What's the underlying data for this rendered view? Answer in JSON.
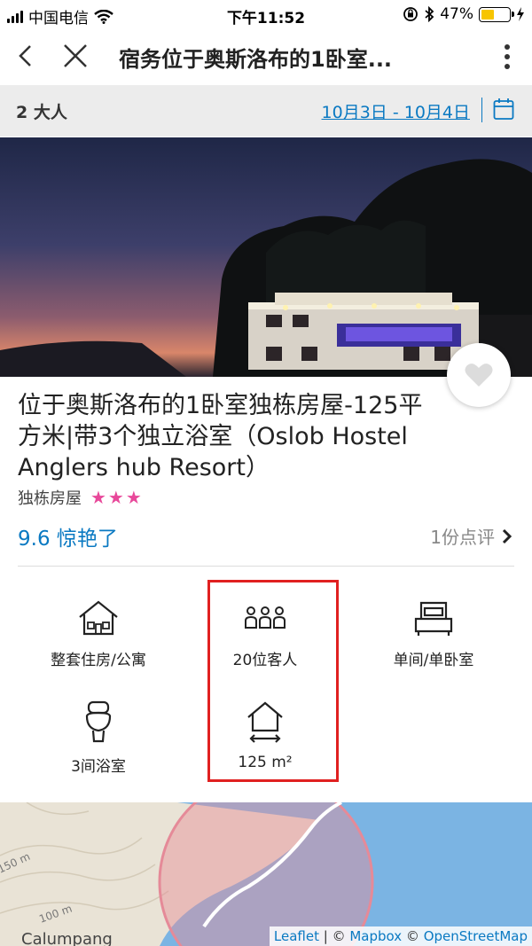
{
  "status_bar": {
    "carrier": "中国电信",
    "time": "下午11:52",
    "battery": "47%",
    "battery_level": 0.47
  },
  "nav": {
    "title": "宿务位于奥斯洛布的1卧室..."
  },
  "search": {
    "guests": "2 大人",
    "dates": "10月3日 - 10月4日"
  },
  "property": {
    "name": "位于奥斯洛布的1卧室独栋房屋-125平方米|带3个独立浴室（Oslob Hostel Anglers hub Resort）",
    "type": "独栋房屋",
    "stars": "★★★",
    "star_count": 3,
    "rating": "9.6 惊艳了",
    "reviews": "1份点评"
  },
  "amenities": [
    {
      "label": "整套住房/公寓",
      "icon": "house-icon"
    },
    {
      "label": "20位客人",
      "icon": "guests-icon"
    },
    {
      "label": "单间/单卧室",
      "icon": "bed-icon"
    },
    {
      "label": "3间浴室",
      "icon": "toilet-icon"
    },
    {
      "label": "125 m²",
      "icon": "area-icon"
    }
  ],
  "map": {
    "labels": [
      "150 m",
      "100 m",
      "Calumpang"
    ],
    "credit_leaflet": "Leaflet",
    "credit_sep": " | © ",
    "credit_mapbox": "Mapbox",
    "credit_sep2": " © ",
    "credit_osm": "OpenStreetMap"
  },
  "colors": {
    "link": "#0a79c2",
    "star": "#e8489a",
    "highlight": "#e02020",
    "summary_bg": "#ececec"
  }
}
